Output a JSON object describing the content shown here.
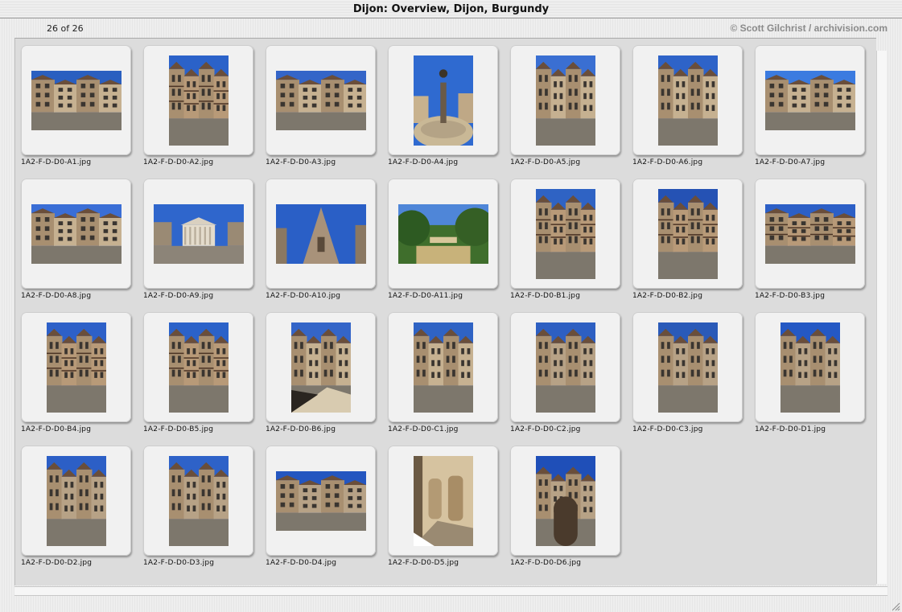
{
  "window": {
    "title": "Dijon: Overview, Dijon, Burgundy"
  },
  "header": {
    "counter": "26 of 26",
    "copyright": "© Scott Gilchrist / archivision.com"
  },
  "thumbnails": [
    {
      "file": "1A2-F-D-D0-A1.jpg",
      "orientation": "landscape",
      "scene": "square",
      "sky": "#2a5fc0"
    },
    {
      "file": "1A2-F-D-D0-A2.jpg",
      "orientation": "portrait",
      "scene": "timber",
      "sky": "#2b62c9"
    },
    {
      "file": "1A2-F-D-D0-A3.jpg",
      "orientation": "landscape",
      "scene": "square",
      "sky": "#3465c8"
    },
    {
      "file": "1A2-F-D-D0-A4.jpg",
      "orientation": "portrait",
      "scene": "fountain",
      "sky": "#2f6ad0"
    },
    {
      "file": "1A2-F-D-D0-A5.jpg",
      "orientation": "portrait",
      "scene": "street",
      "sky": "#3a6fd2"
    },
    {
      "file": "1A2-F-D-D0-A6.jpg",
      "orientation": "portrait",
      "scene": "street",
      "sky": "#2e63c8"
    },
    {
      "file": "1A2-F-D-D0-A7.jpg",
      "orientation": "landscape",
      "scene": "street",
      "sky": "#3b7be0"
    },
    {
      "file": "1A2-F-D-D0-A8.jpg",
      "orientation": "landscape",
      "scene": "street",
      "sky": "#3a6ed6"
    },
    {
      "file": "1A2-F-D-D0-A9.jpg",
      "orientation": "landscape",
      "scene": "temple",
      "sky": "#2f66cc"
    },
    {
      "file": "1A2-F-D-D0-A10.jpg",
      "orientation": "landscape",
      "scene": "church",
      "sky": "#2a5fc6"
    },
    {
      "file": "1A2-F-D-D0-A11.jpg",
      "orientation": "landscape",
      "scene": "park",
      "sky": "#4f86d8"
    },
    {
      "file": "1A2-F-D-D0-B1.jpg",
      "orientation": "portrait",
      "scene": "timber",
      "sky": "#2f63c4"
    },
    {
      "file": "1A2-F-D-D0-B2.jpg",
      "orientation": "portrait",
      "scene": "timber",
      "sky": "#2552b4"
    },
    {
      "file": "1A2-F-D-D0-B3.jpg",
      "orientation": "landscape",
      "scene": "timber",
      "sky": "#2c5fc6"
    },
    {
      "file": "1A2-F-D-D0-B4.jpg",
      "orientation": "portrait",
      "scene": "timber",
      "sky": "#2d60c8"
    },
    {
      "file": "1A2-F-D-D0-B5.jpg",
      "orientation": "portrait",
      "scene": "timber",
      "sky": "#2b62c9"
    },
    {
      "file": "1A2-F-D-D0-B6.jpg",
      "orientation": "portrait",
      "scene": "courtyard",
      "sky": "#3465c8"
    },
    {
      "file": "1A2-F-D-D0-C1.jpg",
      "orientation": "portrait",
      "scene": "street",
      "sky": "#2f63c4"
    },
    {
      "file": "1A2-F-D-D0-C2.jpg",
      "orientation": "portrait",
      "scene": "stone",
      "sky": "#2d5fc2"
    },
    {
      "file": "1A2-F-D-D0-C3.jpg",
      "orientation": "portrait",
      "scene": "stone",
      "sky": "#2a5ab8"
    },
    {
      "file": "1A2-F-D-D0-D1.jpg",
      "orientation": "portrait",
      "scene": "stone",
      "sky": "#2458c4"
    },
    {
      "file": "1A2-F-D-D0-D2.jpg",
      "orientation": "portrait",
      "scene": "stone",
      "sky": "#2c5fc6"
    },
    {
      "file": "1A2-F-D-D0-D3.jpg",
      "orientation": "portrait",
      "scene": "stone",
      "sky": "#2e62c8"
    },
    {
      "file": "1A2-F-D-D0-D4.jpg",
      "orientation": "landscape",
      "scene": "stone",
      "sky": "#2456c0"
    },
    {
      "file": "1A2-F-D-D0-D5.jpg",
      "orientation": "portrait",
      "scene": "wall",
      "sky": "#bfae8e"
    },
    {
      "file": "1A2-F-D-D0-D6.jpg",
      "orientation": "portrait",
      "scene": "gate",
      "sky": "#1f4fb8"
    }
  ],
  "colors": {
    "panel": "#dcdcdc",
    "slide": "#f1f1f1",
    "copyright": "#8a8a8a"
  }
}
